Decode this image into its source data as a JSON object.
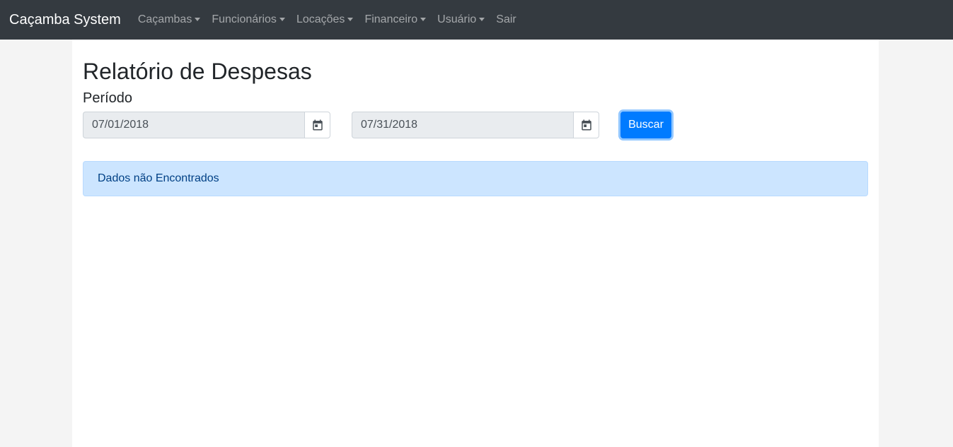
{
  "navbar": {
    "brand": "Caçamba System",
    "items": [
      {
        "label": "Caçambas",
        "dropdown": true
      },
      {
        "label": "Funcionários",
        "dropdown": true
      },
      {
        "label": "Locações",
        "dropdown": true
      },
      {
        "label": "Financeiro",
        "dropdown": true
      },
      {
        "label": "Usuário",
        "dropdown": true
      },
      {
        "label": "Sair",
        "dropdown": false
      }
    ]
  },
  "page": {
    "title": "Relatório de Despesas",
    "period_label": "Período"
  },
  "filters": {
    "start_date": "07/01/2018",
    "end_date": "07/31/2018",
    "calendar_icon": "calendar-icon",
    "search_label": "Buscar"
  },
  "alert": {
    "message": "Dados não Encontrados"
  },
  "colors": {
    "navbar_bg": "#343a40",
    "primary": "#007bff",
    "alert_bg": "#cce5ff",
    "alert_text": "#004085",
    "input_disabled_bg": "#e9ecef"
  }
}
